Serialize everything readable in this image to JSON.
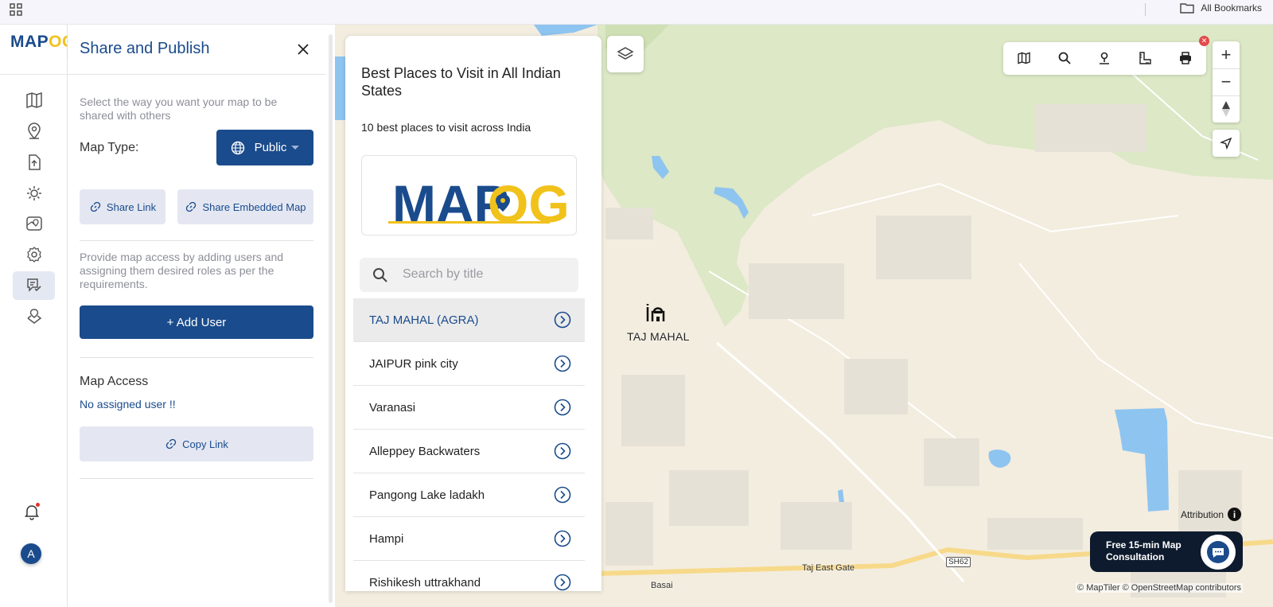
{
  "browser": {
    "bookmarks_label": "All Bookmarks"
  },
  "app": {
    "logo_part1": "MAP",
    "logo_part2": "OG"
  },
  "rail": {
    "items": [
      "map-icon",
      "location-pin-icon",
      "upload-icon",
      "gear-badge-icon",
      "map-pin-icon",
      "settings-icon",
      "publish-icon",
      "map-marker-icon"
    ],
    "active_index": 6,
    "avatar_initial": "A"
  },
  "share_panel": {
    "title": "Share and Publish",
    "intro": "Select the way you want your map to be shared with others",
    "map_type_label": "Map Type:",
    "map_type_value": "Public",
    "share_link_label": "Share Link",
    "share_embedded_label": "Share Embedded Map",
    "access_help": "Provide map access by adding users and assigning them desired roles as per the requirements.",
    "add_user_label": "+ Add User",
    "map_access_title": "Map Access",
    "no_user_text": "No assigned user !!",
    "copy_link_label": "Copy Link"
  },
  "places_card": {
    "title": "Best Places to Visit in All Indian States",
    "subtitle": "10 best places to visit across India",
    "logo_part1": "MAP",
    "logo_part2": "OG",
    "search_placeholder": "Search by title",
    "items": [
      "TAJ MAHAL (AGRA)",
      "JAIPUR pink city",
      "Varanasi",
      "Alleppey Backwaters",
      "Pangong Lake ladakh",
      "Hampi",
      "Rishikesh uttrakhand"
    ],
    "selected_index": 0
  },
  "map": {
    "poi_label": "TAJ MAHAL",
    "labels": {
      "taj_east_gate": "Taj East Gate",
      "basai": "Basai",
      "sh62": "SH62"
    },
    "attribution_label": "Attribution",
    "credits": "© MapTiler © OpenStreetMap contributors",
    "zoom_in": "+",
    "zoom_out": "−",
    "colors": {
      "land": "#f3eddf",
      "forest": "#dce8c6",
      "water": "#8ec4f0",
      "accent": "#1a4b8c"
    }
  },
  "consult": {
    "line1": "Free 15-min Map",
    "line2": "Consultation"
  }
}
